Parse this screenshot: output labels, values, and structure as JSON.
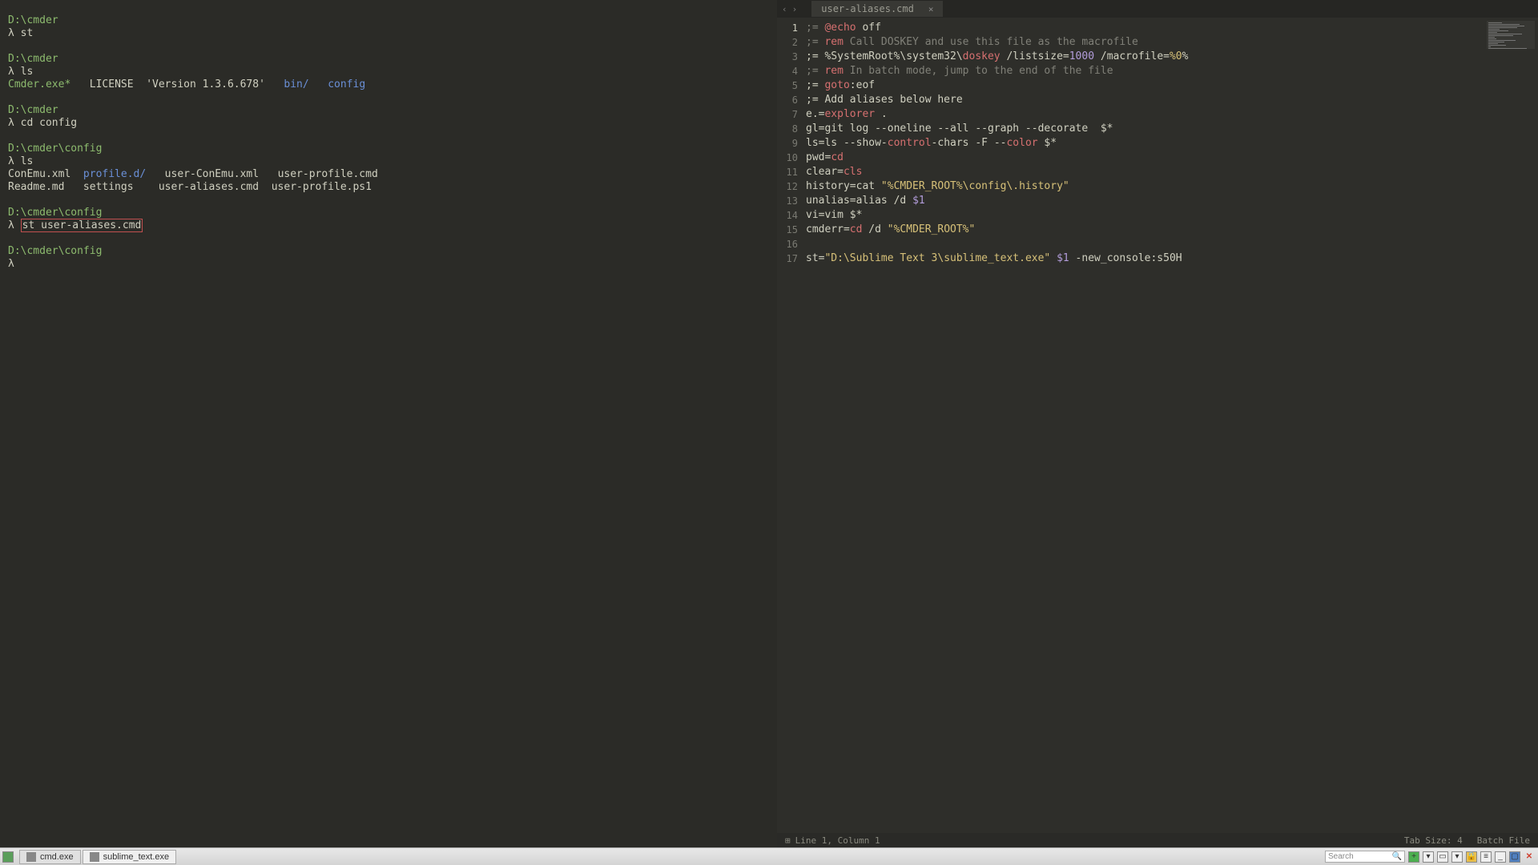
{
  "terminal": {
    "blocks": [
      {
        "path": "D:\\cmder",
        "cmd": "st",
        "output": []
      },
      {
        "path": "D:\\cmder",
        "cmd": "ls",
        "output": [
          [
            {
              "t": "Cmder.exe*",
              "c": "c-green"
            },
            {
              "t": "   LICENSE  'Version 1.3.6.678'   ",
              "c": "c-white"
            },
            {
              "t": "bin/",
              "c": "c-blue"
            },
            {
              "t": "   ",
              "c": ""
            },
            {
              "t": "config",
              "c": "c-blue"
            }
          ]
        ]
      },
      {
        "path": "D:\\cmder",
        "cmd": "cd config",
        "output": []
      },
      {
        "path": "D:\\cmder\\config",
        "cmd": "ls",
        "output": [
          [
            {
              "t": "ConEmu.xml  ",
              "c": "c-white"
            },
            {
              "t": "profile.d/",
              "c": "c-blue"
            },
            {
              "t": "   user-ConEmu.xml   user-profile.cmd",
              "c": "c-white"
            }
          ],
          [
            {
              "t": "Readme.md   settings    user-aliases.cmd  user-profile.ps1",
              "c": "c-white"
            }
          ]
        ]
      },
      {
        "path": "D:\\cmder\\config",
        "cmd": "st user-aliases.cmd",
        "output": [],
        "highlighted": true
      },
      {
        "path": "D:\\cmder\\config",
        "cmd": "",
        "output": []
      }
    ],
    "prompt_symbol": "λ"
  },
  "editor": {
    "tab_name": "user-aliases.cmd",
    "lines": [
      [
        {
          "t": ";= ",
          "c": "c-gray"
        },
        {
          "t": "@echo",
          "c": "c-red"
        },
        {
          "t": " off",
          "c": "c-white"
        }
      ],
      [
        {
          "t": ";= ",
          "c": "c-gray"
        },
        {
          "t": "rem",
          "c": "c-red"
        },
        {
          "t": " Call DOSKEY and use this file as the macrofile",
          "c": "c-gray"
        }
      ],
      [
        {
          "t": ";= %SystemRoot%\\system32\\",
          "c": "c-white"
        },
        {
          "t": "doskey",
          "c": "c-red"
        },
        {
          "t": " /listsize=",
          "c": "c-white"
        },
        {
          "t": "1000",
          "c": "c-num"
        },
        {
          "t": " /macrofile=",
          "c": "c-white"
        },
        {
          "t": "%0",
          "c": "c-yellow"
        },
        {
          "t": "%",
          "c": "c-white"
        }
      ],
      [
        {
          "t": ";= ",
          "c": "c-gray"
        },
        {
          "t": "rem",
          "c": "c-red"
        },
        {
          "t": " In batch mode, jump to the end of the file",
          "c": "c-gray"
        }
      ],
      [
        {
          "t": ";= ",
          "c": "c-white"
        },
        {
          "t": "goto",
          "c": "c-red"
        },
        {
          "t": ":eof",
          "c": "c-white"
        }
      ],
      [
        {
          "t": ";= Add aliases below here",
          "c": "c-white"
        }
      ],
      [
        {
          "t": "e.=",
          "c": "c-white"
        },
        {
          "t": "explorer",
          "c": "c-red"
        },
        {
          "t": " .",
          "c": "c-white"
        }
      ],
      [
        {
          "t": "gl=git log --oneline --all --graph --decorate  $*",
          "c": "c-white"
        }
      ],
      [
        {
          "t": "ls=ls --show-",
          "c": "c-white"
        },
        {
          "t": "control",
          "c": "c-red"
        },
        {
          "t": "-chars -F --",
          "c": "c-white"
        },
        {
          "t": "color",
          "c": "c-red"
        },
        {
          "t": " $*",
          "c": "c-white"
        }
      ],
      [
        {
          "t": "pwd=",
          "c": "c-white"
        },
        {
          "t": "cd",
          "c": "c-red"
        }
      ],
      [
        {
          "t": "clear=",
          "c": "c-white"
        },
        {
          "t": "cls",
          "c": "c-red"
        }
      ],
      [
        {
          "t": "history=cat ",
          "c": "c-white"
        },
        {
          "t": "\"%CMDER_ROOT%\\config\\.history\"",
          "c": "c-yellow"
        }
      ],
      [
        {
          "t": "unalias=alias /d ",
          "c": "c-white"
        },
        {
          "t": "$1",
          "c": "c-num"
        }
      ],
      [
        {
          "t": "vi=vim $*",
          "c": "c-white"
        }
      ],
      [
        {
          "t": "cmderr=",
          "c": "c-white"
        },
        {
          "t": "cd",
          "c": "c-red"
        },
        {
          "t": " /d ",
          "c": "c-white"
        },
        {
          "t": "\"%CMDER_ROOT%\"",
          "c": "c-yellow"
        }
      ],
      [
        {
          "t": "",
          "c": ""
        }
      ],
      [
        {
          "t": "st=",
          "c": "c-white"
        },
        {
          "t": "\"D:\\Sublime Text 3\\sublime_text.exe\"",
          "c": "c-yellow"
        },
        {
          "t": " ",
          "c": ""
        },
        {
          "t": "$1",
          "c": "c-num"
        },
        {
          "t": " -new_console:s50H",
          "c": "c-white"
        }
      ]
    ],
    "status_left": "Line 1, Column 1",
    "status_tab": "Tab Size: 4",
    "status_type": "Batch File"
  },
  "taskbar": {
    "items": [
      "cmd.exe",
      "sublime_text.exe"
    ],
    "search_placeholder": "Search"
  }
}
